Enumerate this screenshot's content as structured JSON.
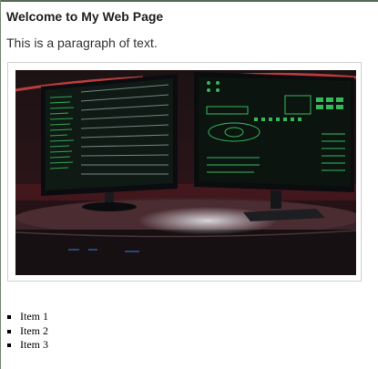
{
  "page": {
    "heading": "Welcome to My Web Page",
    "paragraph": "This is a paragraph of text."
  },
  "image": {
    "alt": "Two computer monitors on a desk displaying green code and interface screens",
    "colors": {
      "bg": "#1a0f12",
      "glow": "#e04040",
      "screen_green": "#3fd46a",
      "desk": "#3a2024"
    }
  },
  "list": {
    "items": [
      "Item 1",
      "Item 2",
      "Item 3"
    ]
  }
}
